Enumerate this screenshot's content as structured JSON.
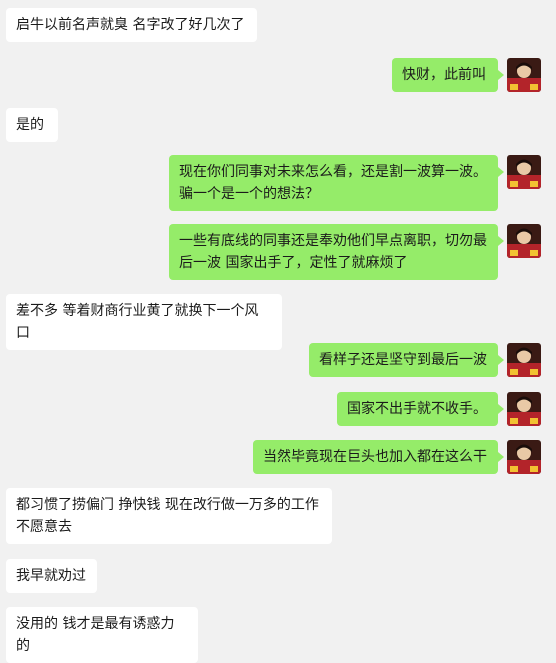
{
  "chat": {
    "messages": [
      {
        "side": "in",
        "text": "启牛以前名声就臭 名字改了好几次了"
      },
      {
        "side": "out",
        "text": "快财，此前叫"
      },
      {
        "side": "in",
        "text": "是的"
      },
      {
        "side": "out",
        "text": "现在你们同事对未来怎么看，还是割一波算一波。骗一个是一个的想法？"
      },
      {
        "side": "out",
        "text": "一些有底线的同事还是奉劝他们早点离职，切勿最后一波 国家出手了，定性了就麻烦了"
      },
      {
        "side": "in",
        "text": "差不多 等着财商行业黄了就换下一个风口"
      },
      {
        "side": "out",
        "text": "看样子还是坚守到最后一波"
      },
      {
        "side": "out",
        "text": "国家不出手就不收手。"
      },
      {
        "side": "out",
        "text": "当然毕竟现在巨头也加入都在这么干"
      },
      {
        "side": "in",
        "text": "都习惯了捞偏门 挣快钱 现在改行做一万多的工作 不愿意去"
      },
      {
        "side": "in",
        "text": "我早就劝过"
      },
      {
        "side": "in",
        "text": "没用的 钱才是最有诱惑力的"
      }
    ]
  },
  "colors": {
    "background": "#f1f1f1",
    "incoming_bubble": "#ffffff",
    "outgoing_bubble": "#95ec69",
    "text": "#1b1b1b"
  },
  "icons": {
    "sender_avatar": "user-avatar-icon"
  }
}
